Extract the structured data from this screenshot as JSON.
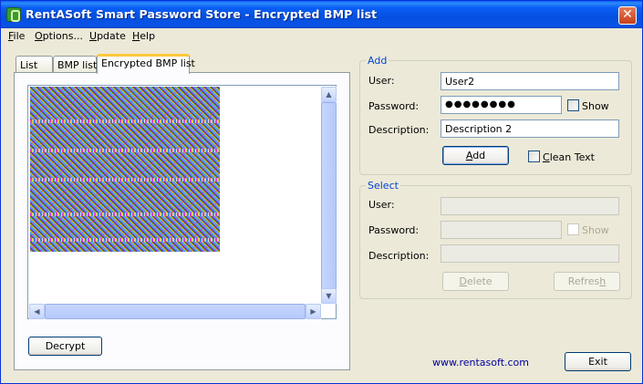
{
  "window": {
    "title": "RentASoft Smart Password Store - Encrypted BMP list",
    "close_symbol": "✕"
  },
  "menu": {
    "file": {
      "accel": "F",
      "rest": "ile"
    },
    "options": {
      "accel": "O",
      "rest": "ptions..."
    },
    "update": {
      "accel": "U",
      "rest": "pdate"
    },
    "help": {
      "accel": "H",
      "rest": "elp"
    }
  },
  "tabs": [
    {
      "label": "List"
    },
    {
      "label": "BMP list"
    },
    {
      "label": "Encrypted BMP list",
      "active": true
    }
  ],
  "image_panel": {
    "decrypt_button": "Decrypt"
  },
  "add_group": {
    "title": "Add",
    "user_label": "User:",
    "user_value": "User2",
    "password_label": "Password:",
    "password_value": "●●●●●●●●",
    "show_label": "Show",
    "description_label": "Description:",
    "description_value": "Description 2",
    "add_button": {
      "accel": "A",
      "rest": "dd"
    },
    "clean_text_label": {
      "accel": "C",
      "rest": "lean Text"
    }
  },
  "select_group": {
    "title": "Select",
    "user_label": "User:",
    "user_value": "",
    "password_label": "Password:",
    "password_value": "",
    "show_label": "Show",
    "description_label": "Description:",
    "description_value": "",
    "delete_button": {
      "accel": "D",
      "rest": "elete"
    },
    "refresh_button": {
      "pre": "Refres",
      "accel": "h"
    }
  },
  "footer": {
    "website": "www.rentasoft.com",
    "exit_button": "Exit"
  },
  "icons": {
    "scroll_up": "▲",
    "scroll_down": "▼",
    "scroll_left": "◀",
    "scroll_right": "▶"
  }
}
